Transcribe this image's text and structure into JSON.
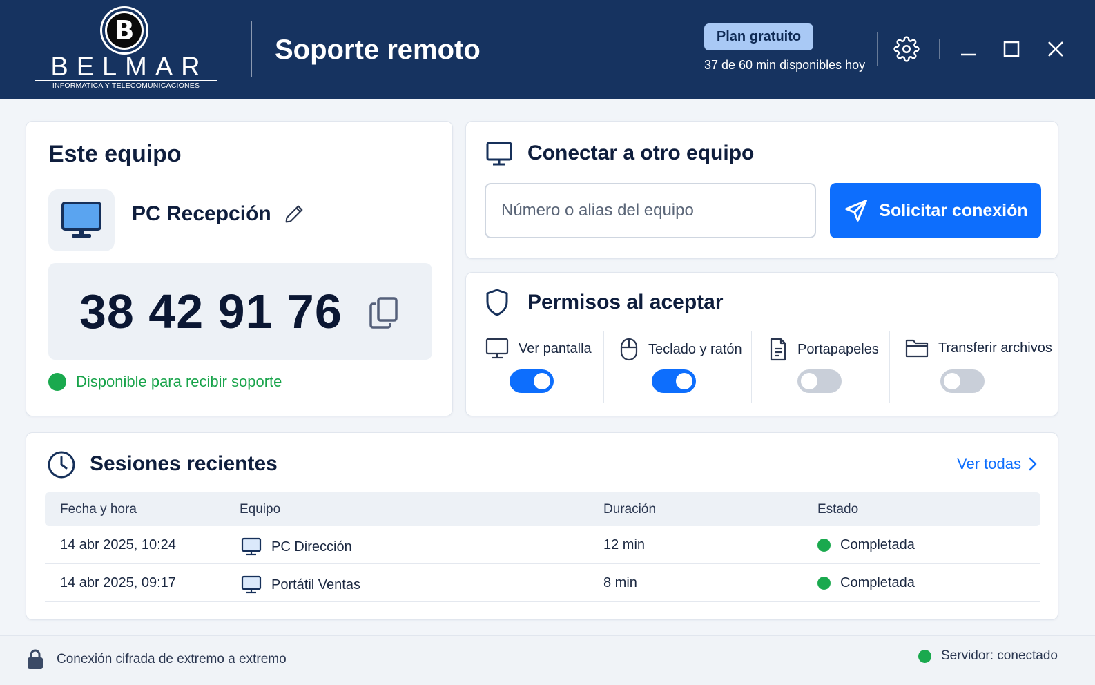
{
  "header": {
    "logo": {
      "letter": "B",
      "name": "BELMAR",
      "tagline": "INFORMATICA Y TELECOMUNICACIONES"
    },
    "title": "Soporte remoto",
    "plan_label": "Plan gratuito",
    "plan_usage": "37 de 60 min disponibles hoy",
    "icons": [
      "gear-icon",
      "minimize-icon",
      "maximize-icon",
      "close-icon"
    ]
  },
  "this_device": {
    "title": "Este equipo",
    "device_name": "PC Recepción",
    "id": "38 42 91 76",
    "status": "Disponible para recibir soporte",
    "status_color": "#1aa94e"
  },
  "connect": {
    "title": "Conectar a otro equipo",
    "input_value": "",
    "input_placeholder": "Número o alias del equipo",
    "button_label": "Solicitar conexión",
    "accent": "#0d6efd"
  },
  "permissions": {
    "title": "Permisos al aceptar",
    "items": [
      {
        "label": "Ver pantalla",
        "icon": "monitor-icon",
        "enabled": true
      },
      {
        "label": "Teclado y ratón",
        "icon": "mouse-icon",
        "enabled": true
      },
      {
        "label": "Portapapeles",
        "icon": "clipboard-icon",
        "enabled": false
      },
      {
        "label": "Transferir archivos",
        "icon": "folder-icon",
        "enabled": false
      }
    ]
  },
  "sessions": {
    "title": "Sesiones recientes",
    "view_all": "Ver todas",
    "columns": [
      "Fecha y hora",
      "Equipo",
      "Duración",
      "Estado"
    ],
    "rows": [
      {
        "date": "14 abr 2025, 10:24",
        "device": "PC Dirección",
        "duration": "12 min",
        "status": "Completada"
      },
      {
        "date": "14 abr 2025, 09:17",
        "device": "Portátil Ventas",
        "duration": "8 min",
        "status": "Completada"
      }
    ]
  },
  "footer": {
    "security": "Conexión cifrada de extremo a extremo",
    "server": "Servidor: conectado"
  }
}
